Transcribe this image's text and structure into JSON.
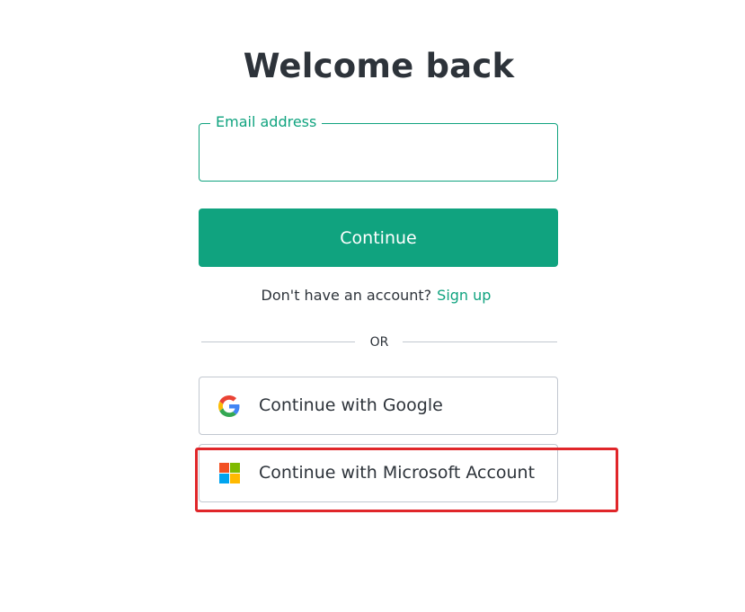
{
  "page": {
    "title": "Welcome back"
  },
  "email": {
    "label": "Email address",
    "value": "",
    "placeholder": ""
  },
  "continue_button": {
    "label": "Continue"
  },
  "signup": {
    "prompt": "Don't have an account?",
    "link_label": "Sign up"
  },
  "divider": {
    "text": "OR"
  },
  "social": {
    "google": {
      "label": "Continue with Google",
      "icon": "google-icon"
    },
    "microsoft": {
      "label": "Continue with Microsoft Account",
      "icon": "microsoft-icon"
    }
  },
  "colors": {
    "accent": "#10a37f",
    "text": "#2d333a",
    "border": "#c2c8d0",
    "highlight": "#e0262a",
    "google_blue": "#4285F4",
    "google_red": "#EA4335",
    "google_yellow": "#FBBC05",
    "google_green": "#34A853",
    "ms_red": "#F25022",
    "ms_green": "#7FBA00",
    "ms_blue": "#00A4EF",
    "ms_yellow": "#FFB900"
  }
}
